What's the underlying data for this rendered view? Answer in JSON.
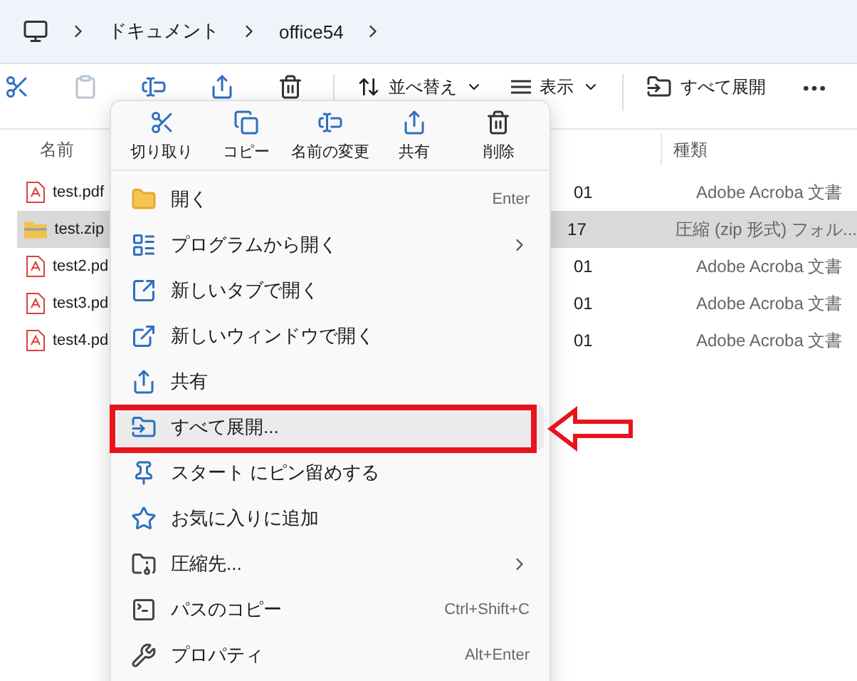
{
  "address_bar": {
    "crumbs": [
      "ドキュメント",
      "office54"
    ]
  },
  "toolbar": [
    {
      "kind": "icon",
      "disabled": false
    },
    {
      "kind": "icon",
      "disabled": true
    },
    {
      "kind": "icon",
      "disabled": false
    },
    {
      "kind": "icon",
      "disabled": false
    },
    {
      "kind": "icon",
      "disabled": false
    },
    {
      "kind": "separator"
    },
    {
      "kind": "dropdown",
      "label": "並べ替え"
    },
    {
      "kind": "dropdown",
      "label": "表示"
    },
    {
      "kind": "separator"
    },
    {
      "kind": "button",
      "label": "すべて展開"
    },
    {
      "kind": "more"
    }
  ],
  "columns": [
    "名前",
    "種類"
  ],
  "files": [
    {
      "kind": "pdf",
      "name": "test.pdf",
      "date": "01",
      "type": "Adobe Acroba 文書",
      "selected": false
    },
    {
      "kind": "zip",
      "name": "test.zip",
      "date": "17",
      "type": "圧縮 (zip 形式) フォル...",
      "selected": true
    },
    {
      "kind": "pdf",
      "name": "test2.pd",
      "date": "01",
      "type": "Adobe Acroba 文書",
      "selected": false
    },
    {
      "kind": "pdf",
      "name": "test3.pd",
      "date": "01",
      "type": "Adobe Acroba 文書",
      "selected": false
    },
    {
      "kind": "pdf",
      "name": "test4.pd",
      "date": "01",
      "type": "Adobe Acroba 文書",
      "selected": false
    }
  ],
  "context_menu": {
    "actions": [
      {
        "label": "切り取り"
      },
      {
        "label": "コピー"
      },
      {
        "label": "名前の変更"
      },
      {
        "label": "共有"
      },
      {
        "label": "削除"
      }
    ],
    "items": [
      {
        "label": "開く",
        "shortcut": "Enter",
        "submenu": false,
        "selected": false,
        "callout": false
      },
      {
        "label": "プログラムから開く",
        "submenu": true,
        "selected": false,
        "callout": false
      },
      {
        "label": "新しいタブで開く",
        "submenu": false,
        "selected": false,
        "callout": false
      },
      {
        "label": "新しいウィンドウで開く",
        "submenu": false,
        "selected": false,
        "callout": false
      },
      {
        "label": "共有",
        "submenu": false,
        "selected": false,
        "callout": false
      },
      {
        "label": "すべて展開...",
        "submenu": false,
        "selected": true,
        "callout": true
      },
      {
        "label": "スタート にピン留めする",
        "submenu": false,
        "selected": false,
        "callout": false
      },
      {
        "label": "お気に入りに追加",
        "submenu": false,
        "selected": false,
        "callout": false
      },
      {
        "label": "圧縮先...",
        "submenu": true,
        "selected": false,
        "callout": false
      },
      {
        "label": "パスのコピー",
        "shortcut": "Ctrl+Shift+C",
        "submenu": false,
        "selected": false,
        "callout": false
      },
      {
        "label": "プロパティ",
        "shortcut": "Alt+Enter",
        "submenu": false,
        "selected": false,
        "callout": false
      }
    ]
  }
}
